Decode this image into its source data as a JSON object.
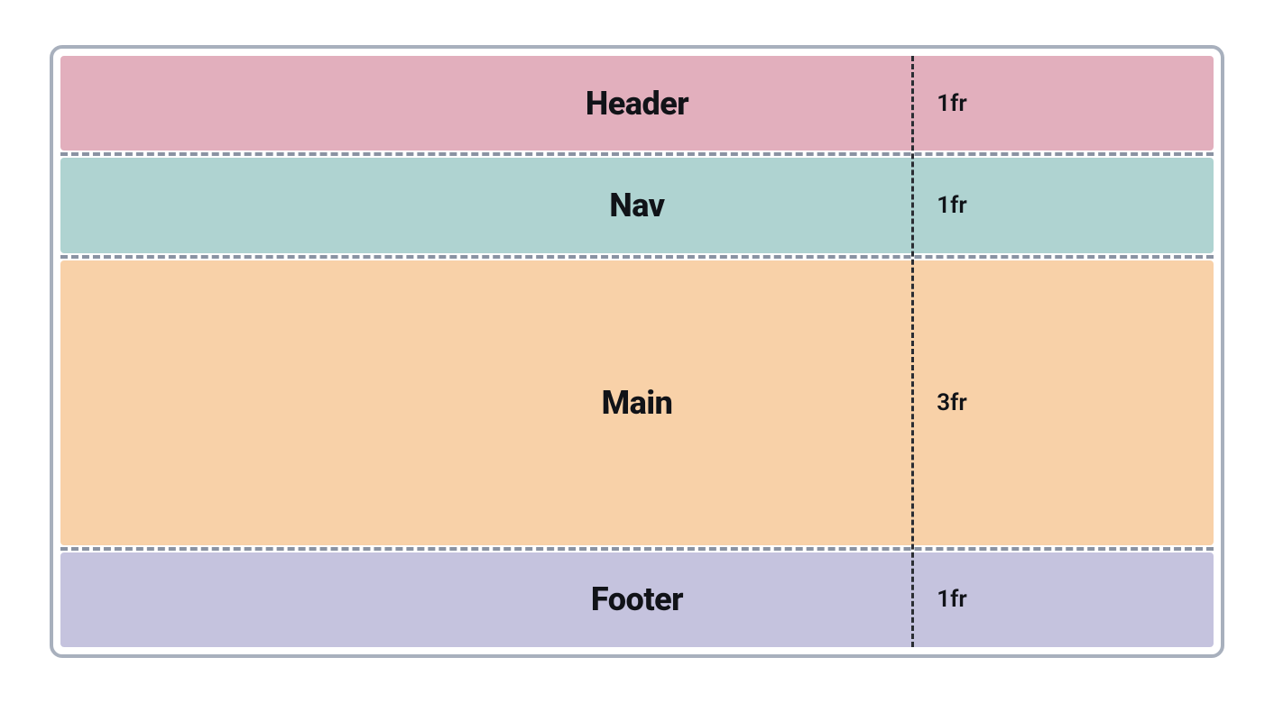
{
  "grid": {
    "rows": [
      {
        "name": "Header",
        "fr": "1fr",
        "color": "#e2afbd"
      },
      {
        "name": "Nav",
        "fr": "1fr",
        "color": "#afd3d1"
      },
      {
        "name": "Main",
        "fr": "3fr",
        "color": "#f8d1a8"
      },
      {
        "name": "Footer",
        "fr": "1fr",
        "color": "#c5c3de"
      }
    ],
    "template_rows": "1fr 1fr 3fr 1fr"
  }
}
